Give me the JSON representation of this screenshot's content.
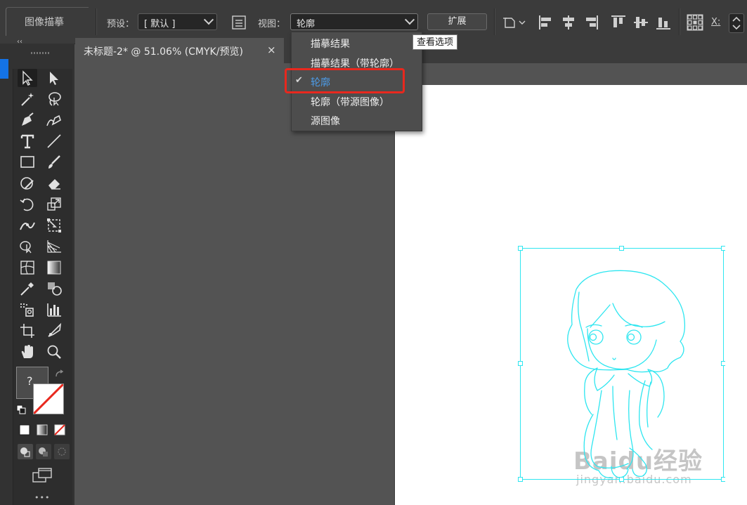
{
  "control_bar": {
    "panel_title": "图像描摹",
    "preset_label": "预设：",
    "preset_value": "[ 默认 ]",
    "view_label": "视图：",
    "view_value": "轮廓",
    "expand_button": "扩展",
    "x_label": "X:"
  },
  "view_menu": {
    "items": [
      {
        "label": "描摹结果",
        "checked": false
      },
      {
        "label": "描摹结果（带轮廓）",
        "checked": false
      },
      {
        "label": "轮廓",
        "checked": true
      },
      {
        "label": "轮廓（带源图像）",
        "checked": false
      },
      {
        "label": "源图像",
        "checked": false
      }
    ]
  },
  "tooltip": "查看选项",
  "document_tab": {
    "title": "未标题-2* @ 51.06% (CMYK/预览)",
    "close_glyph": "×"
  },
  "toolbar": {
    "collapse_glyph": "‹‹",
    "fill_unknown_glyph": "?",
    "more_glyph": "•••"
  },
  "watermark": {
    "logo": "Baidu经验",
    "url": "jingyan.baidu.com"
  },
  "colors": {
    "trace_outline": "#2ee6f0",
    "highlight_box": "#e8281e",
    "active_item": "#4d9ce8"
  }
}
